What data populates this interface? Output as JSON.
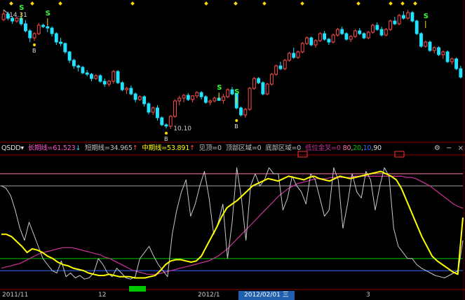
{
  "colors": {
    "background": "#000000",
    "up": "#ff4d4d",
    "down": "#22e3ff",
    "long_line": "#cc3399",
    "short_line": "#c8c8c8",
    "mid_line": "#ffff00",
    "ref_pink": "#ff7aa8",
    "ref_gray": "#a0a0a0",
    "ref_green": "#00c800",
    "ref_blue": "#2f6cff",
    "marker": "#ffd700",
    "signal_s": "#33ff33"
  },
  "legend": {
    "name": "QSDD▾",
    "long": "长期线=61.523",
    "long_arrow": "↓",
    "short": "短期线=34.965",
    "short_arrow": "↑",
    "mid": "中期线=53.891",
    "mid_arrow": "↑",
    "jian_ding": "见顶=0",
    "ding_bu": "顶部区域=0",
    "di_bu": "底部区域=0",
    "di_wei": "低位金叉=0",
    "v80": "80",
    "v20": "20",
    "v10": "10",
    "v90": "90"
  },
  "window_controls": {
    "settings": "⚙",
    "minus": "−",
    "close": "×"
  },
  "x_axis": {
    "labels": [
      "2011/11",
      "12",
      "2012/1",
      "3"
    ],
    "cursor": "2012/02/01 三"
  },
  "annotations": {
    "low": "10.10",
    "high": "14.31",
    "signal_s": "S",
    "signal_b": "B"
  },
  "chart_data": [
    {
      "type": "candlestick",
      "name": "price",
      "y_range": [
        9.8,
        14.5
      ],
      "up_color": "#ff4d4d",
      "down_color": "#22e3ff",
      "ohlc": [
        [
          14.0,
          14.35,
          13.95,
          14.2
        ],
        [
          14.2,
          14.28,
          13.98,
          14.05
        ],
        [
          14.05,
          14.12,
          13.85,
          13.95
        ],
        [
          13.95,
          14.1,
          13.88,
          14.05
        ],
        [
          14.05,
          14.1,
          13.78,
          13.85
        ],
        [
          13.85,
          13.98,
          13.55,
          13.6
        ],
        [
          13.6,
          13.66,
          13.2,
          13.35
        ],
        [
          13.35,
          13.55,
          13.25,
          13.5
        ],
        [
          13.5,
          13.88,
          13.45,
          13.8
        ],
        [
          13.8,
          13.85,
          13.7,
          13.75
        ],
        [
          13.75,
          13.82,
          13.55,
          13.7
        ],
        [
          13.7,
          13.76,
          13.4,
          13.5
        ],
        [
          13.5,
          13.55,
          13.1,
          13.2
        ],
        [
          13.2,
          13.35,
          13.05,
          13.15
        ],
        [
          13.15,
          13.18,
          12.78,
          12.85
        ],
        [
          12.85,
          12.88,
          12.45,
          12.55
        ],
        [
          12.55,
          12.6,
          12.25,
          12.35
        ],
        [
          12.35,
          12.4,
          12.15,
          12.3
        ],
        [
          12.3,
          12.35,
          12.05,
          12.1
        ],
        [
          12.1,
          12.2,
          11.98,
          12.05
        ],
        [
          12.05,
          12.1,
          11.8,
          11.9
        ],
        [
          11.9,
          12.05,
          11.85,
          12.0
        ],
        [
          12.0,
          12.05,
          11.75,
          11.8
        ],
        [
          11.8,
          11.9,
          11.6,
          11.7
        ],
        [
          11.7,
          11.85,
          11.62,
          11.8
        ],
        [
          11.8,
          12.2,
          11.72,
          12.15
        ],
        [
          12.15,
          12.2,
          11.7,
          11.75
        ],
        [
          11.75,
          11.8,
          11.45,
          11.5
        ],
        [
          11.5,
          11.6,
          11.35,
          11.55
        ],
        [
          11.55,
          11.65,
          11.3,
          11.35
        ],
        [
          11.35,
          11.4,
          11.05,
          11.15
        ],
        [
          11.15,
          11.3,
          11.1,
          11.25
        ],
        [
          11.25,
          11.3,
          10.9,
          11.0
        ],
        [
          11.0,
          11.05,
          10.62,
          10.7
        ],
        [
          10.7,
          10.9,
          10.6,
          10.85
        ],
        [
          10.85,
          10.95,
          10.4,
          10.5
        ],
        [
          10.5,
          10.55,
          10.2,
          10.25
        ],
        [
          10.25,
          10.3,
          10.12,
          10.2
        ],
        [
          10.2,
          10.6,
          10.1,
          10.55
        ],
        [
          10.55,
          11.15,
          10.5,
          11.1
        ],
        [
          11.1,
          11.28,
          10.95,
          11.2
        ],
        [
          11.2,
          11.35,
          11.05,
          11.3
        ],
        [
          11.3,
          11.38,
          11.1,
          11.15
        ],
        [
          11.15,
          11.3,
          11.05,
          11.28
        ],
        [
          11.28,
          11.45,
          11.2,
          11.4
        ],
        [
          11.4,
          11.45,
          11.15,
          11.25
        ],
        [
          11.25,
          11.3,
          11.0,
          11.05
        ],
        [
          11.05,
          11.15,
          10.95,
          11.1
        ],
        [
          11.1,
          11.25,
          11.05,
          11.2
        ],
        [
          11.2,
          11.32,
          11.1,
          11.12
        ],
        [
          11.12,
          11.35,
          11.0,
          11.25
        ],
        [
          11.25,
          11.55,
          11.2,
          11.5
        ],
        [
          11.5,
          11.6,
          11.3,
          11.35
        ],
        [
          11.35,
          11.4,
          10.8,
          10.85
        ],
        [
          10.85,
          10.9,
          10.55,
          10.6
        ],
        [
          10.6,
          10.85,
          10.5,
          10.8
        ],
        [
          10.8,
          11.6,
          10.75,
          11.55
        ],
        [
          11.55,
          11.95,
          11.5,
          11.9
        ],
        [
          11.9,
          11.95,
          11.7,
          11.75
        ],
        [
          11.75,
          11.8,
          11.3,
          11.35
        ],
        [
          11.35,
          11.75,
          11.3,
          11.7
        ],
        [
          11.7,
          12.1,
          11.65,
          12.05
        ],
        [
          12.05,
          12.4,
          12.0,
          12.35
        ],
        [
          12.35,
          12.5,
          12.2,
          12.25
        ],
        [
          12.25,
          12.6,
          12.2,
          12.55
        ],
        [
          12.55,
          12.85,
          12.5,
          12.8
        ],
        [
          12.8,
          13.0,
          12.6,
          12.65
        ],
        [
          12.65,
          12.9,
          12.6,
          12.85
        ],
        [
          12.85,
          13.2,
          12.8,
          13.15
        ],
        [
          13.15,
          13.4,
          13.1,
          13.35
        ],
        [
          13.35,
          13.4,
          13.05,
          13.1
        ],
        [
          13.1,
          13.3,
          13.0,
          13.25
        ],
        [
          13.25,
          13.55,
          13.2,
          13.5
        ],
        [
          13.5,
          13.6,
          13.25,
          13.3
        ],
        [
          13.3,
          13.35,
          13.1,
          13.2
        ],
        [
          13.2,
          13.5,
          13.15,
          13.45
        ],
        [
          13.45,
          13.7,
          13.4,
          13.65
        ],
        [
          13.65,
          13.75,
          13.45,
          13.5
        ],
        [
          13.5,
          13.55,
          13.25,
          13.3
        ],
        [
          13.3,
          13.45,
          13.2,
          13.4
        ],
        [
          13.4,
          13.65,
          13.35,
          13.6
        ],
        [
          13.6,
          13.7,
          13.45,
          13.5
        ],
        [
          13.5,
          13.55,
          13.3,
          13.35
        ],
        [
          13.35,
          13.6,
          13.3,
          13.55
        ],
        [
          13.55,
          13.85,
          13.5,
          13.8
        ],
        [
          13.8,
          13.9,
          13.6,
          13.65
        ],
        [
          13.65,
          13.75,
          13.4,
          13.45
        ],
        [
          13.45,
          13.7,
          13.4,
          13.65
        ],
        [
          13.65,
          14.0,
          13.6,
          13.95
        ],
        [
          13.95,
          14.1,
          13.8,
          13.85
        ],
        [
          13.85,
          14.2,
          13.8,
          14.15
        ],
        [
          14.15,
          14.3,
          14.0,
          14.05
        ],
        [
          14.05,
          14.35,
          14.0,
          14.25
        ],
        [
          14.25,
          14.31,
          13.9,
          13.95
        ],
        [
          13.95,
          14.0,
          13.45,
          13.5
        ],
        [
          13.5,
          13.55,
          13.0,
          13.05
        ],
        [
          13.05,
          13.25,
          13.0,
          13.2
        ],
        [
          13.2,
          13.25,
          12.85,
          12.9
        ],
        [
          12.9,
          13.05,
          12.8,
          13.0
        ],
        [
          13.0,
          13.05,
          12.7,
          12.75
        ],
        [
          12.75,
          12.9,
          12.6,
          12.85
        ],
        [
          12.85,
          12.9,
          12.45,
          12.5
        ],
        [
          12.5,
          12.65,
          12.4,
          12.6
        ],
        [
          12.6,
          12.65,
          12.2,
          12.25
        ],
        [
          12.25,
          12.35,
          11.9,
          11.95
        ]
      ]
    },
    {
      "type": "line",
      "name": "QSDD",
      "y_range": [
        -5,
        105
      ],
      "ref_lines": [
        80,
        90,
        20,
        10
      ],
      "series": [
        {
          "name": "长期线",
          "values": [
            12,
            13,
            14,
            15,
            16,
            18,
            20,
            22,
            24,
            25,
            26,
            27,
            28,
            29,
            29,
            29,
            28,
            27,
            26,
            25,
            24,
            23,
            21,
            20,
            18,
            16,
            14,
            12,
            10,
            9,
            8,
            7,
            7,
            7,
            8,
            9,
            10,
            11,
            12,
            13,
            14,
            15,
            16,
            17,
            18,
            20,
            22,
            25,
            28,
            32,
            36,
            40,
            44,
            48,
            52,
            56,
            60,
            64,
            68,
            72,
            75,
            78,
            80,
            82,
            83,
            84,
            85,
            86,
            86,
            86,
            87,
            87,
            87,
            87,
            87,
            88,
            88,
            88,
            88,
            88,
            88,
            88,
            88,
            88,
            88,
            88,
            87,
            87,
            86,
            84,
            82,
            80,
            77,
            74,
            71,
            68,
            65,
            63,
            61.523
          ]
        },
        {
          "name": "短期线",
          "values": [
            80,
            78,
            72,
            60,
            45,
            35,
            50,
            40,
            30,
            20,
            15,
            10,
            8,
            18,
            5,
            8,
            4,
            6,
            3,
            4,
            8,
            20,
            15,
            8,
            5,
            12,
            8,
            4,
            3,
            5,
            20,
            25,
            30,
            22,
            15,
            10,
            5,
            40,
            60,
            75,
            85,
            55,
            65,
            80,
            92,
            70,
            40,
            50,
            65,
            20,
            50,
            95,
            70,
            35,
            80,
            90,
            80,
            85,
            95,
            90,
            90,
            60,
            70,
            88,
            80,
            75,
            65,
            90,
            85,
            70,
            55,
            60,
            95,
            85,
            45,
            65,
            90,
            75,
            70,
            92,
            85,
            60,
            80,
            95,
            88,
            45,
            30,
            25,
            20,
            20,
            15,
            12,
            10,
            8,
            6,
            5,
            4,
            6,
            8,
            10,
            34.965
          ]
        },
        {
          "name": "中期线",
          "values": [
            40,
            40,
            38,
            34,
            30,
            25,
            28,
            27,
            25,
            22,
            20,
            17,
            15,
            14,
            12,
            11,
            10,
            8,
            7,
            6,
            6,
            7,
            6,
            5,
            5,
            5,
            4,
            4,
            4,
            5,
            6,
            10,
            15,
            18,
            19,
            19,
            18,
            17,
            18,
            22,
            30,
            38,
            46,
            55,
            62,
            65,
            68,
            72,
            76,
            80,
            82,
            84,
            86,
            85,
            84,
            86,
            88,
            87,
            86,
            85,
            87,
            88,
            86,
            85,
            84,
            86,
            88,
            87,
            86,
            87,
            88,
            89,
            90,
            91,
            92,
            90,
            88,
            85,
            78,
            68,
            58,
            48,
            38,
            30,
            22,
            18,
            15,
            12,
            9,
            7,
            53.891
          ]
        }
      ]
    }
  ]
}
